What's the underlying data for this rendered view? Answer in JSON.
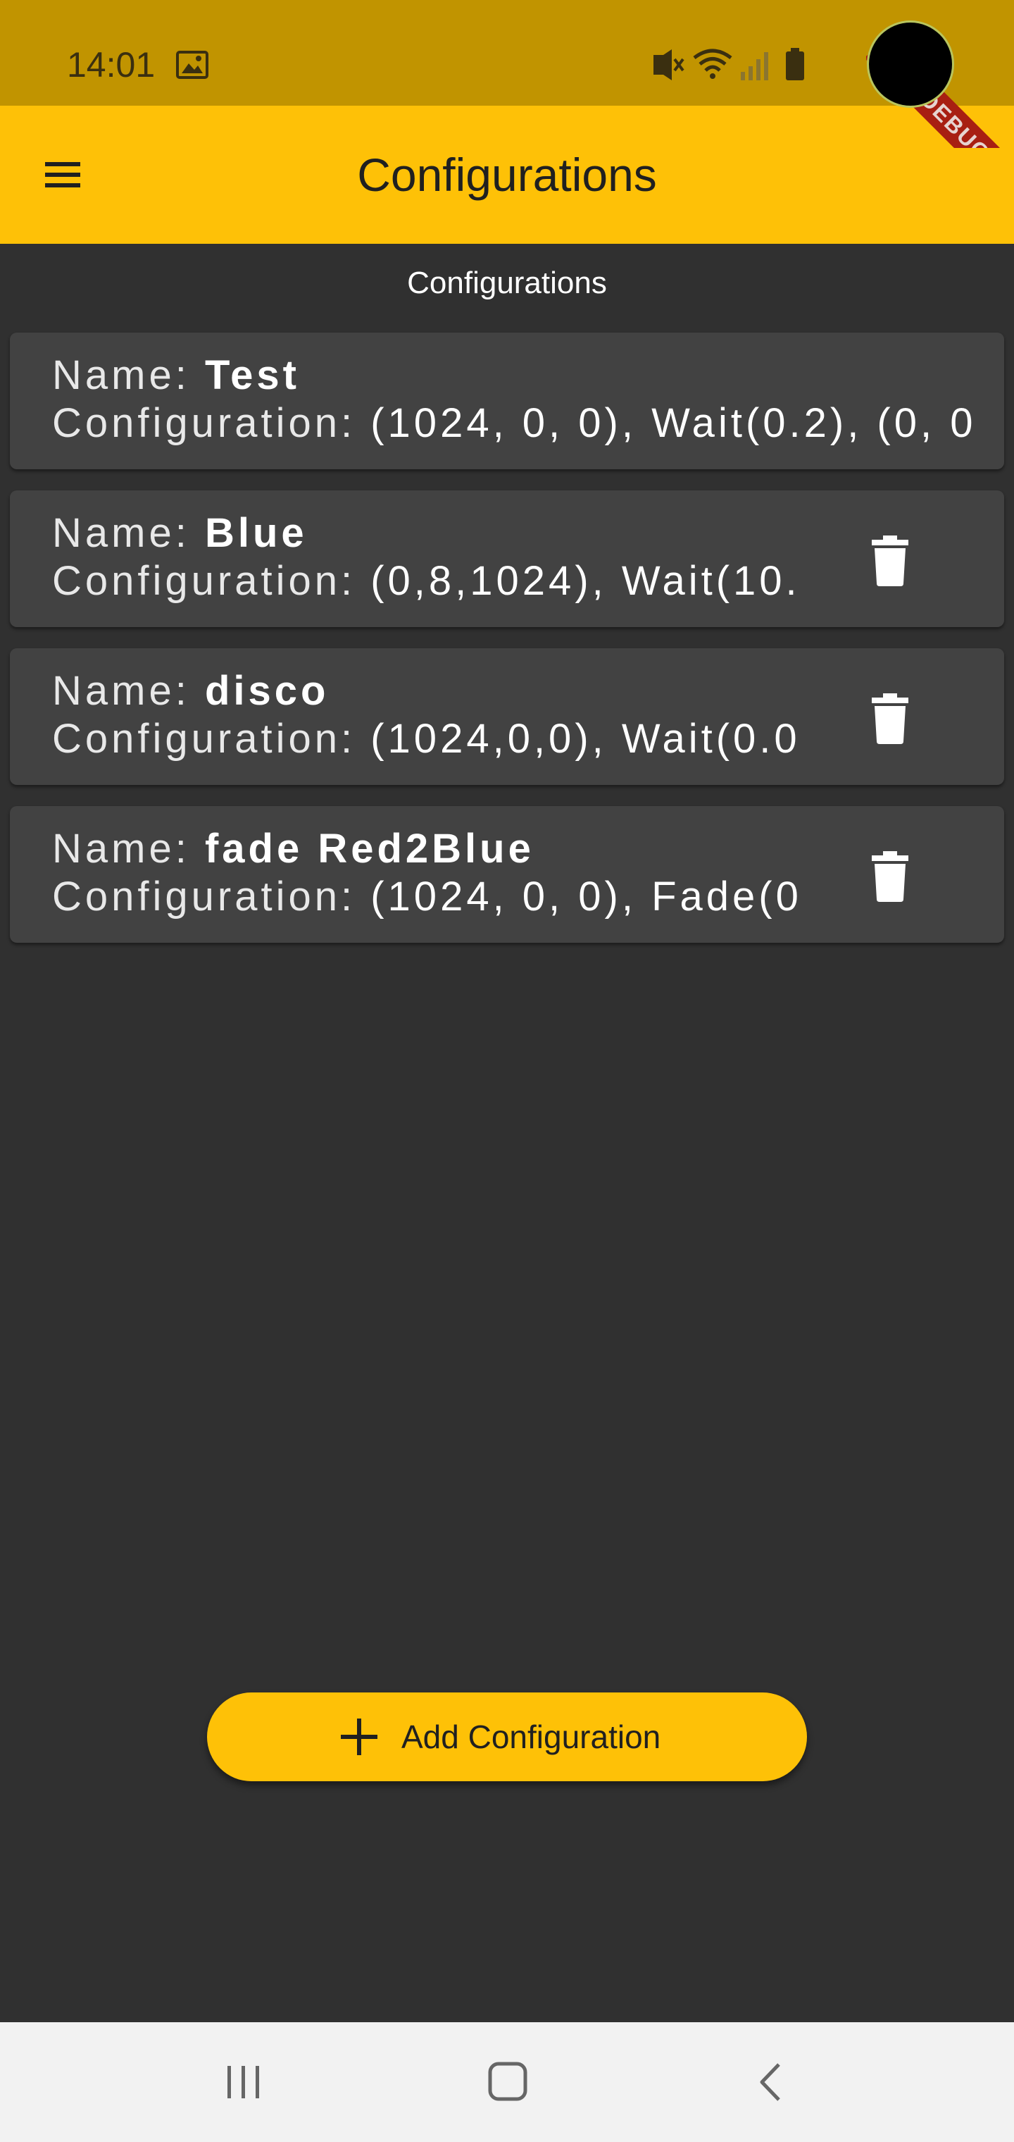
{
  "status_bar": {
    "time": "14:01",
    "icons": [
      "image-icon",
      "vibrate-icon",
      "wifi-icon",
      "signal-icon",
      "battery-icon"
    ]
  },
  "debug_banner": {
    "label": "DEBUG"
  },
  "app_bar": {
    "title": "Configurations",
    "menu_icon": "menu-icon"
  },
  "list_header": "Configurations",
  "configurations": [
    {
      "name_label": "Name: ",
      "name": "Test",
      "config_label": "Configuration: ",
      "config": "(1024, 0, 0), Wait(0.2), (0, 0",
      "delete_icon": ""
    },
    {
      "name_label": "Name: ",
      "name": "Blue",
      "config_label": "Configuration: ",
      "config": "(0,8,1024), Wait(10.",
      "delete_icon": "trash-icon"
    },
    {
      "name_label": "Name: ",
      "name": "disco",
      "config_label": "Configuration: ",
      "config": "(1024,0,0), Wait(0.0",
      "delete_icon": "trash-icon"
    },
    {
      "name_label": "Name: ",
      "name": "fade Red2Blue",
      "config_label": "Configuration: ",
      "config": "(1024, 0, 0), Fade(0",
      "delete_icon": "trash-icon"
    }
  ],
  "add_button": {
    "label": "Add Configuration",
    "icon": "plus-icon"
  },
  "nav_bar": {
    "icons": [
      "recent-apps-icon",
      "home-icon",
      "back-icon"
    ]
  },
  "colors": {
    "status_bar": "#c19400",
    "app_bar": "#fec107",
    "background": "#303030",
    "card": "#424242",
    "debug_ribbon": "#a81f12",
    "nav_bar": "#f2f2f2"
  }
}
